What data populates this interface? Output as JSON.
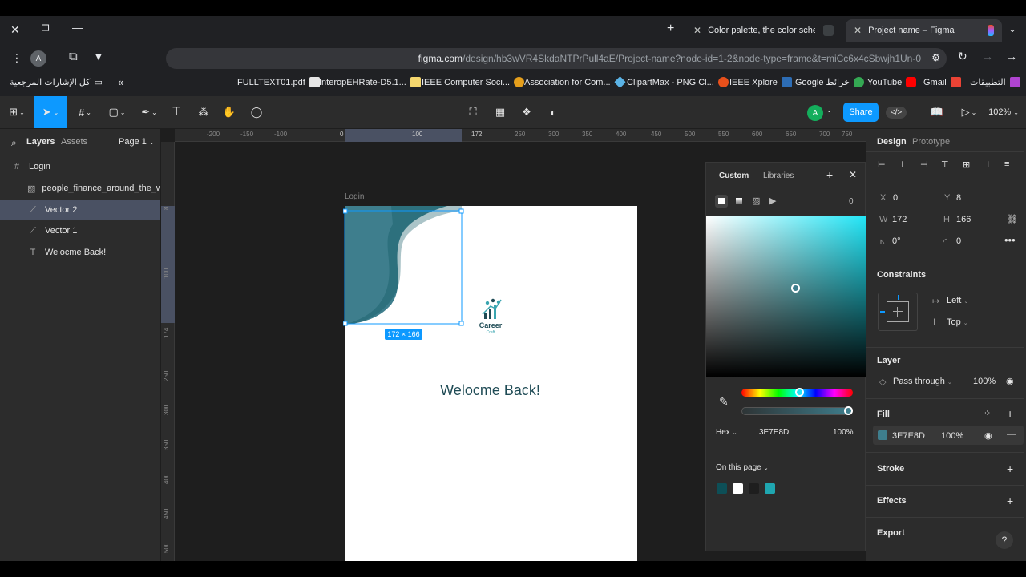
{
  "browser": {
    "tabs": [
      {
        "title": "Color palette, the color scheme",
        "active": false
      },
      {
        "title": "Project name – Figma",
        "active": true
      }
    ],
    "url_domain": "figma.com",
    "url_path": "/design/hb3wVR4SkdaNTPrPull4aE/Project-name?node-id=1-2&node-type=frame&t=miCc6x4cSbwjh1Un-0",
    "bookmarks": [
      {
        "label": "كل الإشارات المرجعية"
      },
      {
        "label": "FULLTEXT01.pdf",
        "color": "#e6e6e6"
      },
      {
        "label": "InteropEHRate-D5.1...",
        "color": "#f5d76e"
      },
      {
        "label": "IEEE Computer Soci...",
        "color": "#e59f1c"
      },
      {
        "label": "Association for Com...",
        "color": "#5bb3e6"
      },
      {
        "label": "ClipartMax - PNG Cl...",
        "color": "#e8501b"
      },
      {
        "label": "IEEE Xplore",
        "color": "#2d6db5"
      },
      {
        "label": "Google خرائط",
        "color": "#34a853"
      },
      {
        "label": "YouTube",
        "color": "#ff0000"
      },
      {
        "label": "Gmail",
        "color": "#ea4335"
      },
      {
        "label": "التطبيقات",
        "color": "#b044d1"
      }
    ]
  },
  "toolbar": {
    "share_label": "Share",
    "zoom": "102%",
    "avatar_initial": "A"
  },
  "left_panel": {
    "tabs": [
      "Layers",
      "Assets"
    ],
    "page": "Page 1",
    "layers": [
      {
        "name": "Login",
        "icon": "frame-icon",
        "selected": false,
        "indent": 0
      },
      {
        "name": "people_finance_around_the_w...",
        "icon": "image-icon",
        "selected": false,
        "indent": 1
      },
      {
        "name": "Vector 2",
        "icon": "vector-icon",
        "selected": true,
        "indent": 1
      },
      {
        "name": "Vector 1",
        "icon": "vector-icon",
        "selected": false,
        "indent": 1
      },
      {
        "name": "Welocme Back!",
        "icon": "text-icon",
        "selected": false,
        "indent": 1
      }
    ]
  },
  "canvas": {
    "frame_label": "Login",
    "welcome_text": "Welocme Back!",
    "size_badge": "172 × 166",
    "logo_text": "Career",
    "logo_sub": "Craft",
    "ruler_top": [
      "-200",
      "-150",
      "-100",
      "0",
      "100",
      "172",
      "250",
      "300",
      "350",
      "400",
      "450",
      "500",
      "550",
      "600",
      "650",
      "700",
      "750"
    ],
    "ruler_left": [
      "8",
      "100",
      "174",
      "250",
      "300",
      "350",
      "400",
      "450",
      "500"
    ]
  },
  "color_picker": {
    "tabs": [
      "Custom",
      "Libraries"
    ],
    "mode": "Hex",
    "hex": "3E7E8D",
    "opacity": "100%",
    "count": "0",
    "on_this_page": "On this page",
    "swatches": [
      "#0d4f57",
      "#ffffff",
      "#1e1e1e",
      "#1fa6b0"
    ]
  },
  "right_panel": {
    "tabs": [
      "Design",
      "Prototype"
    ],
    "x_label": "X",
    "x": "0",
    "y_label": "Y",
    "y": "8",
    "w_label": "W",
    "w": "172",
    "h_label": "H",
    "h": "166",
    "rotation": "0°",
    "radius": "0",
    "constraints_title": "Constraints",
    "constraint_h": "Left",
    "constraint_v": "Top",
    "layer_title": "Layer",
    "blend": "Pass through",
    "layer_opacity": "100%",
    "fill_title": "Fill",
    "fill_hex": "3E7E8D",
    "fill_opacity": "100%",
    "fill_color": "#3e7e8d",
    "stroke_title": "Stroke",
    "effects_title": "Effects",
    "export_title": "Export"
  }
}
